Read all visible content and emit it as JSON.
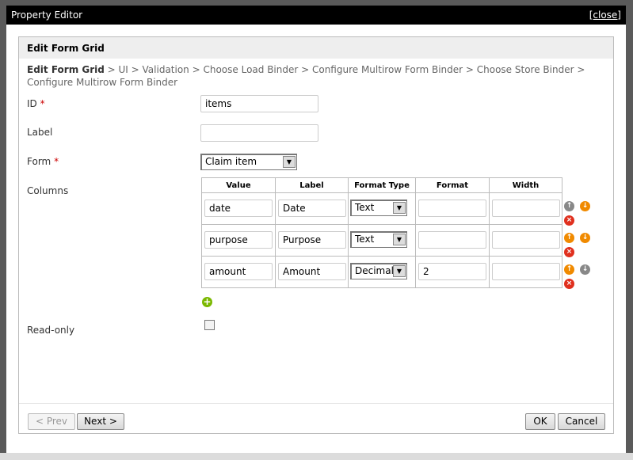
{
  "window": {
    "title": "Property Editor",
    "close_label": "[close]"
  },
  "panel": {
    "title": "Edit Form Grid",
    "breadcrumb": {
      "current": "Edit Form Grid",
      "rest": " > UI > Validation > Choose Load Binder > Configure Multirow Form Binder > Choose Store Binder > Configure Multirow Form Binder"
    }
  },
  "fields": {
    "id": {
      "label": "ID",
      "required": "*",
      "value": "items"
    },
    "label": {
      "label": "Label",
      "value": ""
    },
    "form": {
      "label": "Form",
      "required": "*",
      "value": "Claim item"
    },
    "columns": {
      "label": "Columns",
      "headers": [
        "Value",
        "Label",
        "Format Type",
        "Format",
        "Width"
      ],
      "rows": [
        {
          "value": "date",
          "label": "Date",
          "format_type": "Text",
          "format": "",
          "width": ""
        },
        {
          "value": "purpose",
          "label": "Purpose",
          "format_type": "Text",
          "format": "",
          "width": ""
        },
        {
          "value": "amount",
          "label": "Amount",
          "format_type": "Decimal",
          "format": "2",
          "width": ""
        }
      ]
    },
    "readonly": {
      "label": "Read-only",
      "checked": false
    }
  },
  "buttons": {
    "prev": "< Prev",
    "next": "Next >",
    "ok": "OK",
    "cancel": "Cancel"
  },
  "colors": {
    "titlebar": "#000000",
    "up_down_active": "#f08a00",
    "disabled_arrow": "#888888",
    "delete": "#e0301e",
    "add": "#7ab800"
  }
}
